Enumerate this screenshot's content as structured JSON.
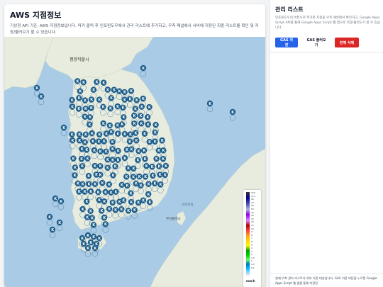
{
  "main": {
    "title": "AWS 지점정보",
    "description": "기상청 API 기준, AWS 지점정보입니다. 마커 클릭 후 인포윈도우에서 관리 리스트에 추가하고, 우측 패널에서 서버에 저장된 최종 리스트를 확인 및 저장/불러오기 할 수 있습니다."
  },
  "map": {
    "labels": {
      "pyongyang": "평양직할시",
      "sea_korea": "대한해협",
      "busan": "부산광역시"
    },
    "marker_glyph": "K",
    "marker_color": "#1f5f8b",
    "legend": {
      "ticks": [
        "150",
        "110",
        "90",
        "70",
        "60",
        "50",
        "40",
        "30",
        "25",
        "20",
        "15",
        "10",
        "9",
        "8",
        "7",
        "6",
        "5",
        "4",
        "3",
        "2",
        "1.5",
        "1",
        "0.5",
        "0.1"
      ],
      "unit": "mm/h"
    }
  },
  "panel": {
    "title": "관리 리스트",
    "description": "인포윈도우의 버튼으로 추가한 지점을 우측 패널에서 확인하고, Google Apps Script API를 통해 Google Apps Script 웹 앱으로 저장/불러오기 할 수 있습니다.",
    "buttons": {
      "save": "GAS 저장",
      "load": "GAS 불러오기",
      "delete": "전체 삭제"
    },
    "footer": "현재 우측 관리 리스트가 외부 저장 대상입니다. GAS 저장 버튼을 누르면 Google Apps Script 웹 앱을 통해 저장된"
  },
  "colors": {
    "primary": "#2563eb",
    "danger": "#dc2626",
    "sea": "#a9cbe6",
    "land": "#e8ecdf"
  }
}
